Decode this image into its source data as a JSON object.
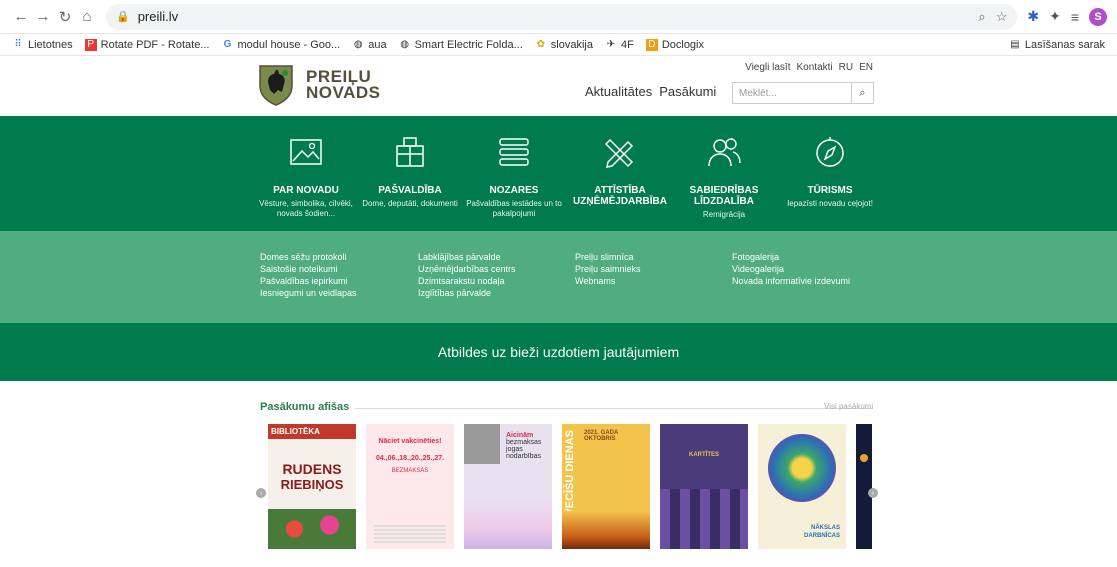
{
  "browser": {
    "url": "preili.lv",
    "bookmarks": [
      {
        "label": "Lietotnes"
      },
      {
        "label": "Rotate PDF - Rotate..."
      },
      {
        "label": "modul house - Goo..."
      },
      {
        "label": "aua"
      },
      {
        "label": "Smart Electric Folda..."
      },
      {
        "label": "slovakija"
      },
      {
        "label": "4F"
      },
      {
        "label": "Doclogix"
      }
    ],
    "reading_list": "Lasīšanas sarak",
    "avatar_letter": "S"
  },
  "header": {
    "logo_line1": "PREIĻU",
    "logo_line2": "NOVADS",
    "top_links": [
      "Viegli lasīt",
      "Kontakti",
      "RU",
      "EN"
    ],
    "nav": [
      "Aktualitātes",
      "Pasākumi"
    ],
    "search_placeholder": "Meklēt..."
  },
  "categories": [
    {
      "title": "PAR NOVADU",
      "sub": "Vēsture, simbolika, cilvēki, novads šodien...",
      "icon": "image-icon"
    },
    {
      "title": "PAŠVALDĪBA",
      "sub": "Dome, deputāti, dokumenti",
      "icon": "building-icon"
    },
    {
      "title": "NOZARES",
      "sub": "Pašvaldības iestādes un to pakalpojumi",
      "icon": "list-icon"
    },
    {
      "title": "ATTĪSTĪBA UZŅĒMĒJDARBĪBA",
      "sub": "",
      "icon": "pencil-ruler-icon"
    },
    {
      "title": "SABIEDRĪBAS LĪDZDALĪBA",
      "sub": "Remigrācija",
      "icon": "people-icon"
    },
    {
      "title": "TŪRISMS",
      "sub": "Iepazīsti novadu ceļojot!",
      "icon": "compass-icon"
    }
  ],
  "quick_links": [
    [
      "Domes sēžu protokoli",
      "Saistošie noteikumi",
      "Pašvaldības iepirkumi",
      "Iesniegumi un veidlapas"
    ],
    [
      "Labklājības pārvalde",
      "Uzņēmējdarbības centrs",
      "Dzimtsarakstu nodaļa",
      "Izglītības pārvalde"
    ],
    [
      "Preiļu slimnīca",
      "Preiļu saimnieks",
      "Webnams"
    ],
    [
      "Fotogalerija",
      "Videogalerija",
      "Novada informatīvie izdevumi"
    ]
  ],
  "faq": "Atbildes uz bieži uzdotiem jautājumiem",
  "events": {
    "title": "Pasākumu afišas",
    "all_link": "Visi pasākumi",
    "posters": [
      {
        "line1": "BIBLIOTĒKA",
        "line2": "RUDENS",
        "line3": "RIEBIŅOS",
        "bg": "#f5f0ea",
        "accent": "#c0392b"
      },
      {
        "line1": "Nāciet vakcinēties!",
        "line2": "04.,06.,18.,20.,25.,27.",
        "line3": "BEZMAKSAS",
        "bg": "#fde8ec",
        "accent": "#d62d4a"
      },
      {
        "line1": "Aicinām",
        "line2": "bezmaksas",
        "line3": "jogas nodarbības",
        "bg": "#e8e2f0",
        "accent": "#8e44ad"
      },
      {
        "line1": "SVECĪŠU DIENAS",
        "line2": "2021. GADA OKTOBRIS",
        "line3": "",
        "bg": "#f3c44b",
        "accent": "#8a4a12"
      },
      {
        "line1": "KARTĪTES",
        "line2": "",
        "line3": "",
        "bg": "#4a3b7a",
        "accent": "#e2c14b"
      },
      {
        "line1": "NĀKSLAS",
        "line2": "DARBNĪCAS",
        "line3": "",
        "bg": "#f6f0d8",
        "accent": "#2c6fb5"
      },
      {
        "line1": "",
        "line2": "",
        "line3": "",
        "bg": "#151a3a",
        "accent": "#e5a52c"
      }
    ]
  }
}
